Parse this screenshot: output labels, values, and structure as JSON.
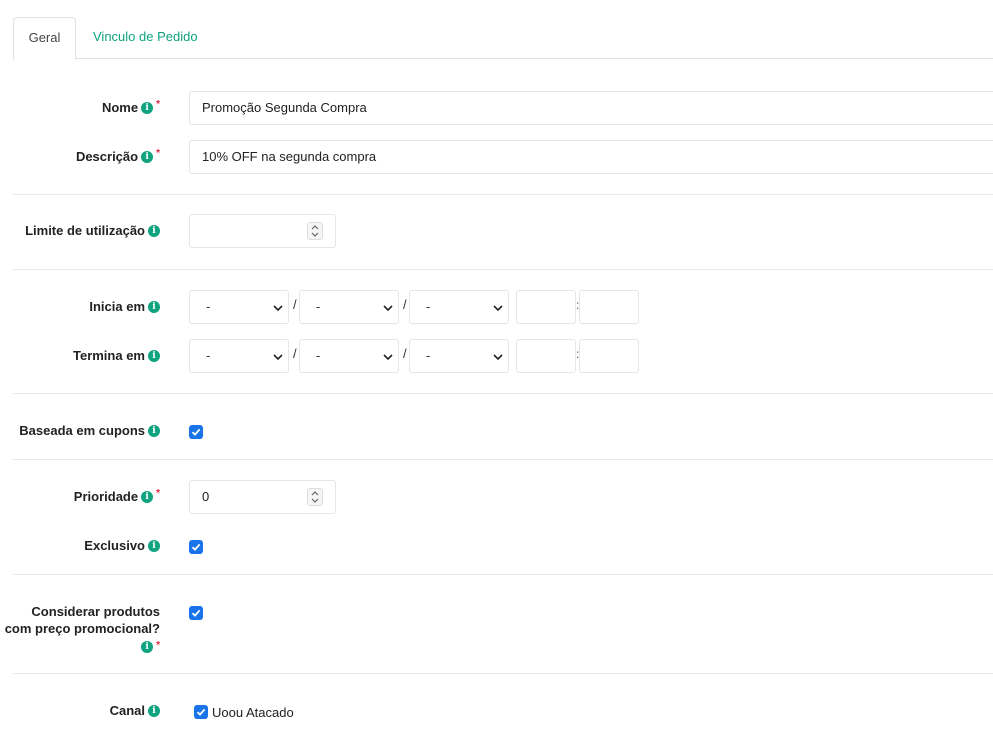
{
  "tabs": [
    {
      "label": "Geral"
    },
    {
      "label": "Vinculo de Pedido"
    }
  ],
  "form": {
    "nome": {
      "label": "Nome",
      "value": "Promoção Segunda Compra",
      "required": "*"
    },
    "descricao": {
      "label": "Descrição",
      "value": "10% OFF na segunda compra",
      "required": "*"
    },
    "limite": {
      "label": "Limite de utilização",
      "value": ""
    },
    "inicia": {
      "label": "Inicia em",
      "day": "-",
      "month": "-",
      "year": "-",
      "hour": "",
      "minute": ""
    },
    "termina": {
      "label": "Termina em",
      "day": "-",
      "month": "-",
      "year": "-",
      "hour": "",
      "minute": ""
    },
    "cupons": {
      "label": "Baseada em cupons",
      "checked": true
    },
    "prioridade": {
      "label": "Prioridade",
      "value": "0",
      "required": "*"
    },
    "exclusivo": {
      "label": "Exclusivo",
      "checked": true
    },
    "considerar": {
      "label_line1": "Considerar produtos",
      "label_line2": "com preço promocional?",
      "required": "*",
      "checked": true
    },
    "canal": {
      "label": "Canal",
      "option": "Uoou Atacado",
      "checked": true
    }
  },
  "icons": {
    "info": "info-icon",
    "chevron": "chevron-down-icon",
    "spinner": "number-spinner-icon",
    "check": "check-icon"
  },
  "colors": {
    "accent": "#0fa37f",
    "checkbox": "#1a73e8",
    "required": "#e3243b"
  },
  "separators": {
    "date": "/",
    "time": ":"
  }
}
